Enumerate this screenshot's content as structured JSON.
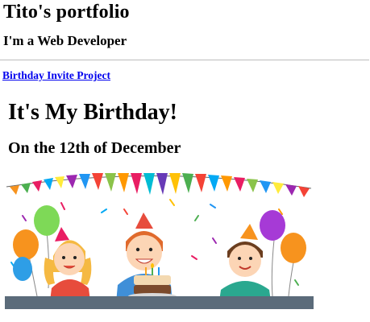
{
  "header": {
    "title": "Tito's portfolio",
    "subtitle": "I'm a Web Developer"
  },
  "nav": {
    "project_link": "Birthday Invite Project"
  },
  "invite": {
    "heading": "It's My Birthday!",
    "date_line": "On the 12th of December"
  },
  "colors": {
    "link": "#0000ee",
    "divider": "#bdbdbd"
  },
  "image": {
    "description_icon": "birthday-party-illustration"
  }
}
